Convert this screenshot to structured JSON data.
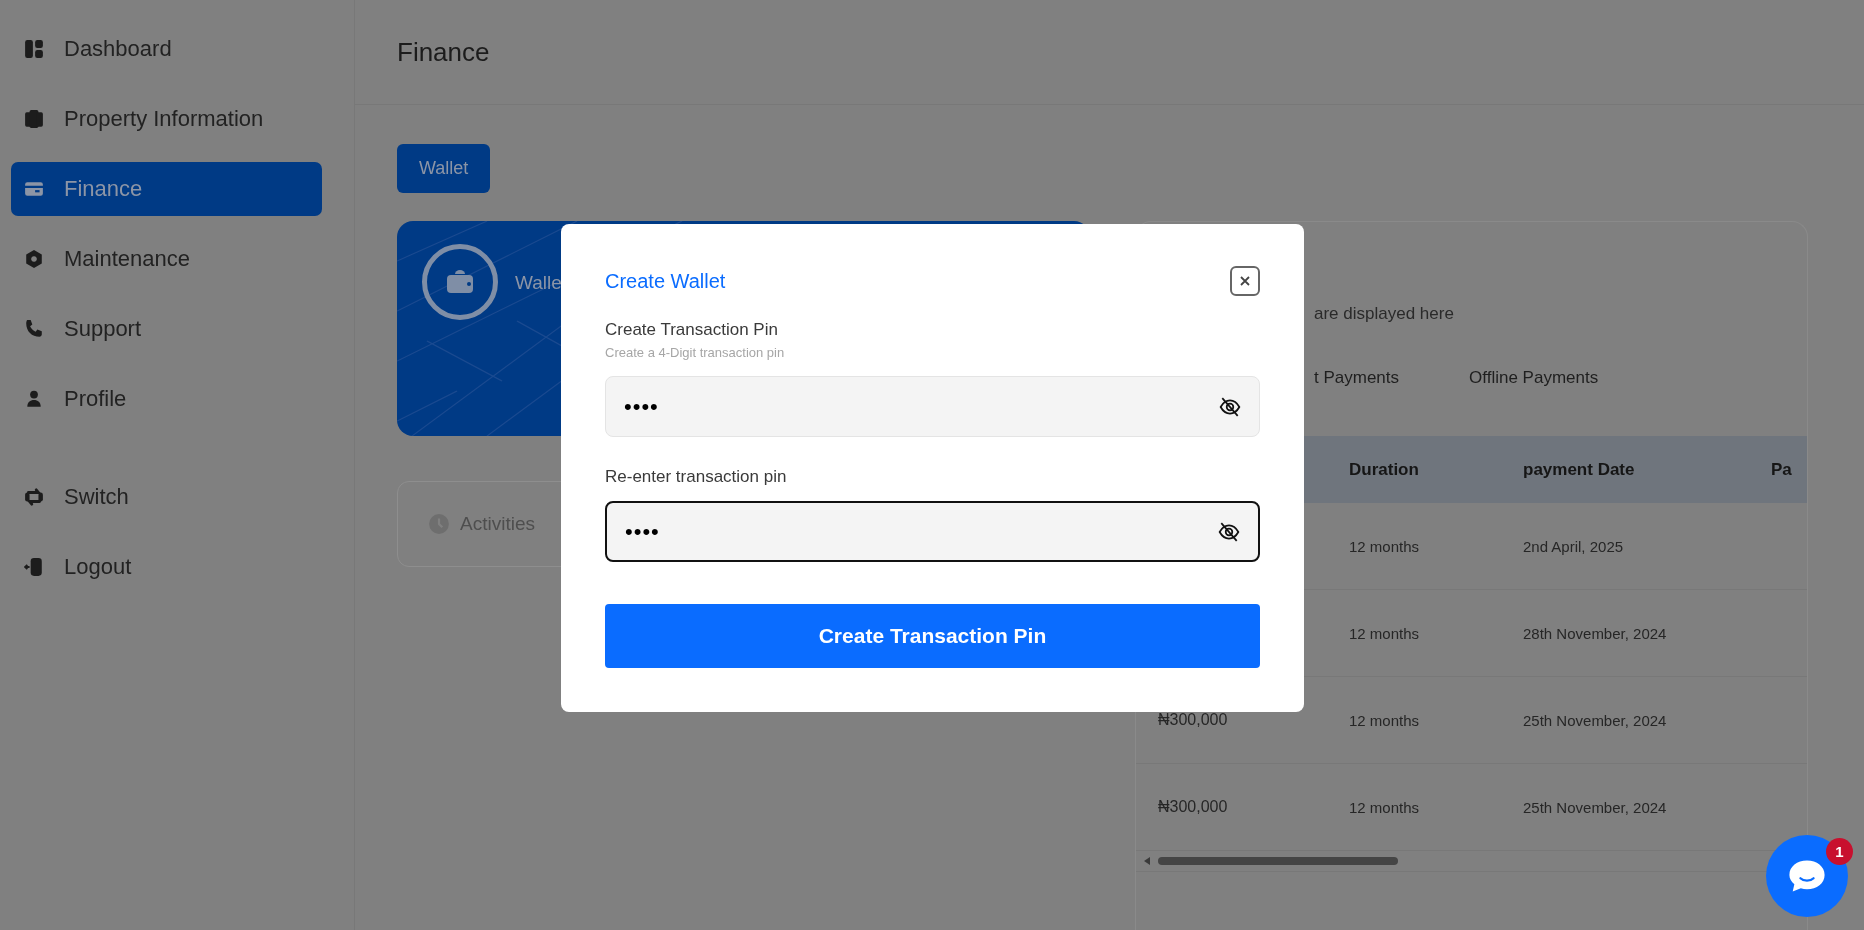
{
  "sidebar": {
    "items": [
      {
        "label": "Dashboard",
        "selected": false
      },
      {
        "label": "Property Information",
        "selected": false
      },
      {
        "label": "Finance",
        "selected": true
      },
      {
        "label": "Maintenance",
        "selected": false
      },
      {
        "label": "Support",
        "selected": false
      },
      {
        "label": "Profile",
        "selected": false
      }
    ],
    "bottom_items": [
      {
        "label": "Switch"
      },
      {
        "label": "Logout"
      }
    ]
  },
  "page_title": "Finance",
  "tabs": [
    {
      "label": "Wallet",
      "selected": true
    }
  ],
  "wallet_card": {
    "label": "Walle"
  },
  "activities": {
    "label": "Activities"
  },
  "payments_panel": {
    "subtitle": "are displayed here",
    "tabs": [
      "t Payments",
      "Offline Payments"
    ],
    "table": {
      "columns": [
        "Duration",
        "payment Date",
        "Pa"
      ],
      "rows": [
        {
          "duration": "12 months",
          "payment_date": "2nd April, 2025"
        },
        {
          "duration": "12 months",
          "payment_date": "28th November, 2024"
        },
        {
          "amount": "₦300,000",
          "duration": "12 months",
          "payment_date": "25th November, 2024"
        },
        {
          "amount": "₦300,000",
          "duration": "12 months",
          "payment_date": "25th November, 2024"
        }
      ]
    }
  },
  "modal": {
    "title": "Create Wallet",
    "fields": [
      {
        "label": "Create Transaction Pin",
        "hint": "Create a 4-Digit transaction pin",
        "value": "••••",
        "focused": false
      },
      {
        "label": "Re-enter transaction pin",
        "value": "••••",
        "focused": true
      }
    ],
    "submit": "Create Transaction Pin"
  },
  "chat_widget": {
    "badge": "1"
  }
}
